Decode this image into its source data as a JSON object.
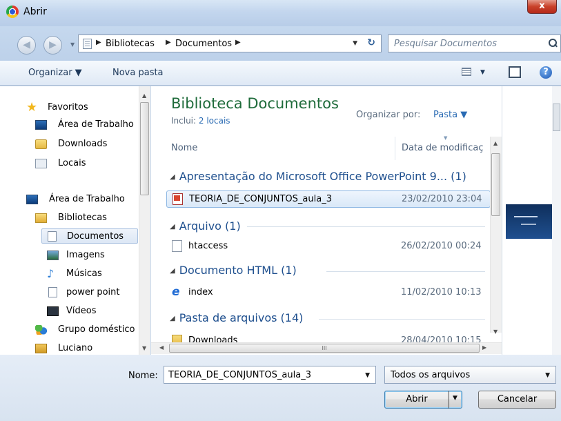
{
  "window": {
    "title": "Abrir",
    "close_label": "x"
  },
  "address": {
    "crumbs": [
      "Bibliotecas",
      "Documentos"
    ],
    "search_placeholder": "Pesquisar Documentos"
  },
  "toolbar": {
    "organize": "Organizar ▼",
    "new_folder": "Nova pasta"
  },
  "nav": {
    "favorites": "Favoritos",
    "fav_items": [
      "Área de Trabalho",
      "Downloads",
      "Locais"
    ],
    "desktop": "Área de Trabalho",
    "libraries": "Bibliotecas",
    "lib_items": [
      "Documentos",
      "Imagens",
      "Músicas",
      "power point",
      "Vídeos"
    ],
    "homegroup": "Grupo doméstico",
    "user": "Luciano"
  },
  "library": {
    "title": "Biblioteca Documentos",
    "includes_prefix": "Inclui:",
    "includes_link": "2 locais",
    "arrange_label": "Organizar por:",
    "arrange_value": "Pasta ▼"
  },
  "columns": {
    "name": "Nome",
    "date": "Data de modificaç"
  },
  "groups": [
    {
      "header": "Apresentação do Microsoft Office PowerPoint 9... (1)",
      "files": [
        {
          "name": "TEORIA_DE_CONJUNTOS_aula_3",
          "date": "23/02/2010 23:04",
          "icon": "ppt-icon",
          "selected": true
        }
      ]
    },
    {
      "header": "Arquivo (1)",
      "files": [
        {
          "name": "htaccess",
          "date": "26/02/2010 00:24",
          "icon": "file-icon"
        }
      ]
    },
    {
      "header": "Documento HTML (1)",
      "files": [
        {
          "name": "index",
          "date": "11/02/2010 10:13",
          "icon": "ie-icon"
        }
      ]
    },
    {
      "header": "Pasta de arquivos (14)",
      "files": [
        {
          "name": "Downloads",
          "date": "28/04/2010 10:15",
          "icon": "folder-icon"
        }
      ]
    }
  ],
  "footer": {
    "name_label": "Nome:",
    "name_value": "TEORIA_DE_CONJUNTOS_aula_3",
    "filter_value": "Todos os arquivos",
    "open_label": "Abrir",
    "cancel_label": "Cancelar"
  },
  "scrollbar_grip": "III"
}
